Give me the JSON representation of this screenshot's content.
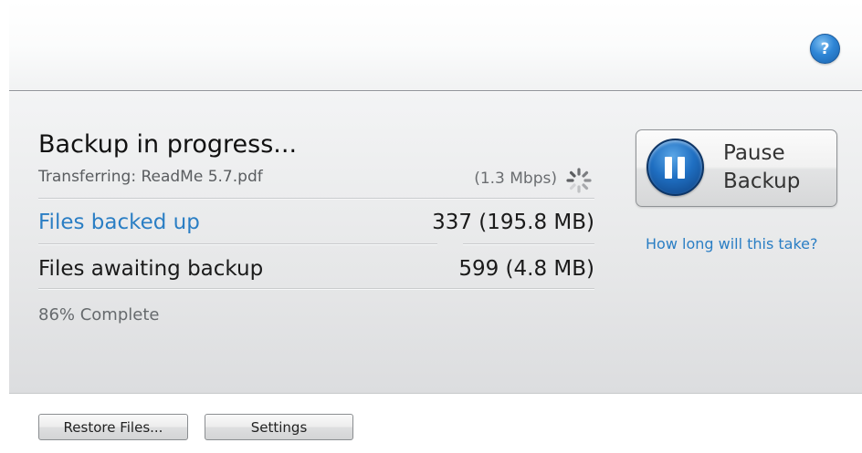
{
  "header": {
    "help_label": "?"
  },
  "status": {
    "title": "Backup in progress...",
    "transferring": "Transferring: ReadMe 5.7.pdf",
    "rate": "(1.3 Mbps)"
  },
  "stats": {
    "backed_up_label": "Files backed up",
    "backed_up_value": "337 (195.8 MB)",
    "awaiting_label": "Files awaiting backup",
    "awaiting_value": "599 (4.8 MB)"
  },
  "progress": {
    "label": "86% Complete",
    "percent": 86
  },
  "actions": {
    "pause_line1": "Pause",
    "pause_line2": "Backup",
    "estimate_link": "How long will this take?"
  },
  "footer": {
    "restore_label": "Restore Files...",
    "settings_label": "Settings"
  },
  "colors": {
    "link": "#2a7ec4",
    "pause_button_accent": "#1f6fc2"
  },
  "icons": {
    "help": "help-icon",
    "spinner": "spinner-icon",
    "pause": "pause-icon"
  }
}
